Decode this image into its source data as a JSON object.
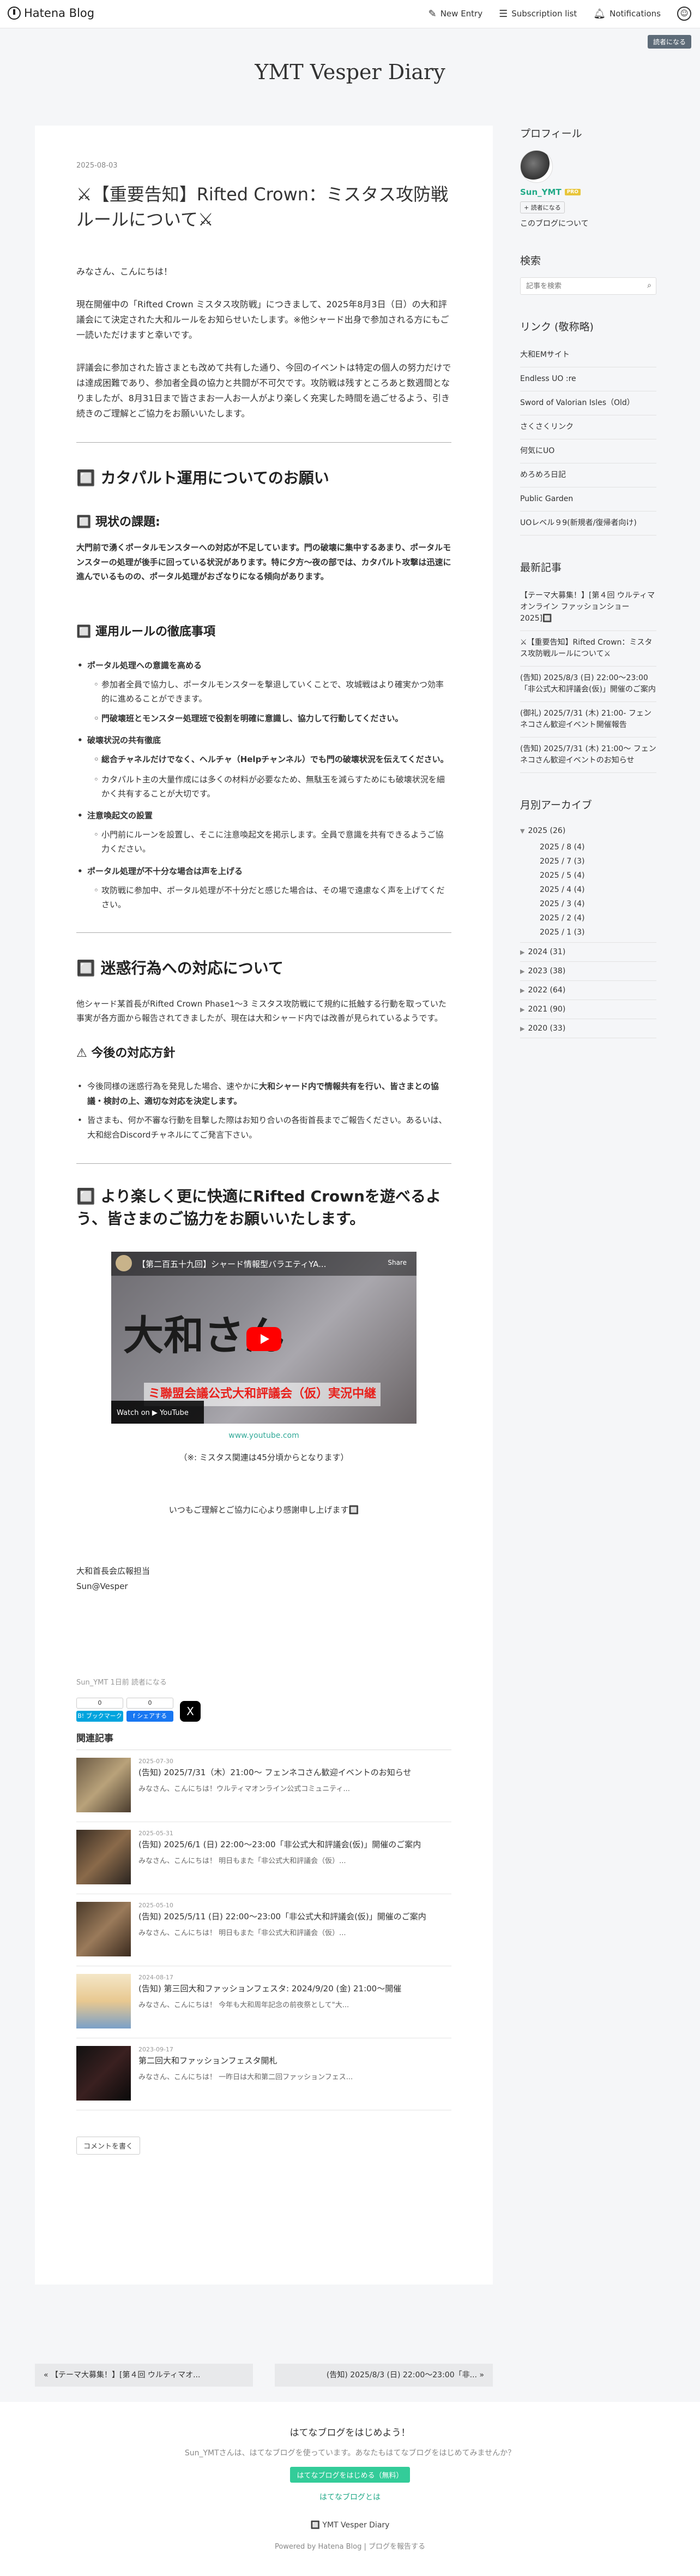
{
  "global_header": {
    "logo": "Hatena Blog",
    "new_entry": "New Entry",
    "subscription_list": "Subscription list",
    "notifications": "Notifications",
    "reader_button": "読者になる"
  },
  "blog_title": "YMT Vesper Diary",
  "entry": {
    "date": "2025-08-03",
    "title": "⚔【重要告知】Rifted Crown：ミスタス攻防戦ルールについて⚔",
    "greeting": "みなさん、こんにちは！",
    "intro": "現在開催中の「Rifted Crown ミスタス攻防戦」につきまして、2025年8月3日（日）の大和評議会にて決定された大和ルールをお知らせいたします。※他シャード出身で参加される方にもご一読いただけますと幸いです。",
    "intro2": "評議会に参加された皆さまとも改めて共有した通り、今回のイベントは特定の個人の努力だけでは達成困難であり、参加者全員の協力と共闘が不可欠です。攻防戦は残すところあと数週間となりましたが、8月31日まで皆さまお一人お一人がより楽しく充実した時間を過ごせるよう、引き続きのご理解とご協力をお願いいたします。",
    "s1_title": "🔲 カタパルト運用についてのお願い",
    "s1_sub1": "🔲 現状の課題:",
    "s1_issue": "大門前で湧くポータルモンスターへの対応が不足しています。門の破壊に集中するあまり、ポータルモンスターの処理が後手に回っている状況があります。特に夕方〜夜の部では、カタパルト攻撃は迅速に進んでいるものの、ポータル処理がおざなりになる傾向があります。",
    "s1_sub2": "🔲 運用ルールの徹底事項",
    "rules": [
      {
        "label": "ポータル処理への意識を高める",
        "items": [
          {
            "text": "参加者全員で協力し、ポータルモンスターを撃退していくことで、攻城戦はより確実かつ効率的に進めることができます。",
            "bold": false
          },
          {
            "text": "門破壊班とモンスター処理班で役割を明確に意識し、協力して行動してください。",
            "bold": true
          }
        ]
      },
      {
        "label": "破壊状況の共有徹底",
        "items": [
          {
            "text": "総合チャネルだけでなく、ヘルチャ（Helpチャンネル）でも門の破壊状況を伝えてください。",
            "bold": true
          },
          {
            "text": "カタパルト主の大量作成には多くの材料が必要なため、無駄玉を減らすためにも破壊状況を細かく共有することが大切です。",
            "bold": false
          }
        ]
      },
      {
        "label": "注意喚起文の設置",
        "items": [
          {
            "text": "小門前にルーンを設置し、そこに注意喚起文を掲示します。全員で意識を共有できるようご協力ください。",
            "bold": false
          }
        ]
      },
      {
        "label": "ポータル処理が不十分な場合は声を上げる",
        "items": [
          {
            "text": "攻防戦に参加中、ポータル処理が不十分だと感じた場合は、その場で遠慮なく声を上げてください。",
            "bold": false
          }
        ]
      }
    ],
    "s2_title": "🔲 迷惑行為への対応について",
    "s2_text": "他シャード某首長がRifted Crown Phase1〜3 ミスタス攻防戦にて規約に抵触する行動を取っていた事実が各方面から報告されてきましたが、現在は大和シャード内では改善が見られているようです。",
    "s2_sub": "⚠ 今後の対応方針",
    "s2_items": [
      {
        "pre": "今後同様の迷惑行為を発見した場合、速やかに",
        "bold": "大和シャード内で情報共有を行い、皆さまとの協議・検討の上、適切な対応を決定します。",
        "post": ""
      },
      {
        "pre": "皆さまも、何か不審な行動を目撃した際はお知り合いの各街首長までご報告ください。あるいは、大和総合Discordチャネルにてご発言下さい。",
        "bold": "",
        "post": ""
      }
    ],
    "s3_title": "🔲 より楽しく更に快適にRifted Crownを遊べるよう、皆さまのご協力をお願いいたします。",
    "video": {
      "title": "【第二百五十九回】シャード情報型バラエティYA...",
      "share": "Share",
      "big_text": "大和さん",
      "red_text": "ミ聯盟会議公式大和評議会（仮）実況中継",
      "watch": "Watch on ▶ YouTube"
    },
    "youtube_link": "www.youtube.com",
    "video_note": "（※: ミスタス関連は45分頃からとなります）",
    "thanks": "いつもご理解とご協力に心より感謝申し上げます🔲",
    "signature_1": "大和首長会広報担当",
    "signature_2": "Sun@Vesper",
    "footer_meta": "Sun_YMT 1日前   読者になる",
    "share": {
      "hatena_count": "0",
      "hatena_label": "B! ブックマーク",
      "fb_count": "0",
      "fb_label": "f シェアする",
      "x_label": "X"
    },
    "related_title": "関連記事",
    "related": [
      {
        "date": "2025-07-30",
        "title": "(告知) 2025/7/31（木）21:00～ フェンネコさん歓迎イベントのお知らせ",
        "snippet": "みなさん、こんにちは！ウルティマオンライン公式コミュニティ..."
      },
      {
        "date": "2025-05-31",
        "title": "(告知) 2025/6/1 (日) 22:00〜23:00「非公式大和評議会(仮)」開催のご案内",
        "snippet": "みなさん、こんにちは！ 明日もまた「非公式大和評議会（仮）..."
      },
      {
        "date": "2025-05-10",
        "title": "(告知) 2025/5/11 (日) 22:00〜23:00「非公式大和評議会(仮)」開催のご案内",
        "snippet": "みなさん、こんにちは！ 明日もまた「非公式大和評議会（仮）..."
      },
      {
        "date": "2024-08-17",
        "title": "(告知) 第三回大和ファッションフェスタ: 2024/9/20 (金) 21:00〜開催",
        "snippet": "みなさん、こんにちは！ 今年も大和周年記念の前夜祭として\"大..."
      },
      {
        "date": "2023-09-17",
        "title": "第二回大和ファッションフェスタ開札",
        "snippet": "みなさん、こんにちは！ 一昨日は大和第二回ファッションフェス..."
      }
    ],
    "comment_button": "コメントを書く"
  },
  "sidebar": {
    "profile_heading": "プロフィール",
    "username": "Sun_YMT",
    "pro_badge": "PRO",
    "reader_button": "+ 読者になる",
    "about": "このブログについて",
    "search_heading": "検索",
    "search_placeholder": "記事を検索",
    "links_heading": "リンク (敬称略)",
    "links": [
      "大和EMサイト",
      "Endless UO :re",
      "Sword of Valorian Isles（Old）",
      "さくさくリンク",
      "何気にUO",
      "めろめろ日記",
      "Public Garden",
      "UOレベル９9(新規者/復帰者向け)"
    ],
    "recent_heading": "最新記事",
    "recent": [
      "【テーマ大募集！】[第４回 ウルティマオンライン ファッションショー 2025]🔲",
      "⚔【重要告知】Rifted Crown：ミスタス攻防戦ルールについて⚔",
      "(告知) 2025/8/3 (日) 22:00〜23:00「非公式大和評議会(仮)」開催のご案内",
      "(御礼) 2025/7/31 (木) 21:00- フェンネコさん歓迎イベント開催報告",
      "(告知) 2025/7/31 (木) 21:00～ フェンネコさん歓迎イベントのお知らせ"
    ],
    "archive_heading": "月別アーカイブ",
    "archive_open_year": "2025 (26)",
    "archive_months": [
      "2025 / 8 (4)",
      "2025 / 7 (3)",
      "2025 / 5 (4)",
      "2025 / 4 (4)",
      "2025 / 3 (4)",
      "2025 / 2 (4)",
      "2025 / 1 (3)"
    ],
    "archive_years": [
      "2024 (31)",
      "2023 (38)",
      "2022 (64)",
      "2021 (90)",
      "2020 (33)"
    ]
  },
  "pager": {
    "prev": "« 【テーマ大募集！】[第４回 ウルティマオ...",
    "next": "(告知) 2025/8/3 (日) 22:00〜23:00「非...  »"
  },
  "footer": {
    "title": "はてなブログをはじめよう！",
    "text": "Sun_YMTさんは、はてなブログを使っています。あなたもはてなブログをはじめてみませんか？",
    "start_button": "はてなブログをはじめる（無料）",
    "about_link": "はてなブログとは",
    "blog_name": "🔲 YMT Vesper Diary",
    "powered": "Powered by Hatena Blog | ブログを報告する"
  }
}
